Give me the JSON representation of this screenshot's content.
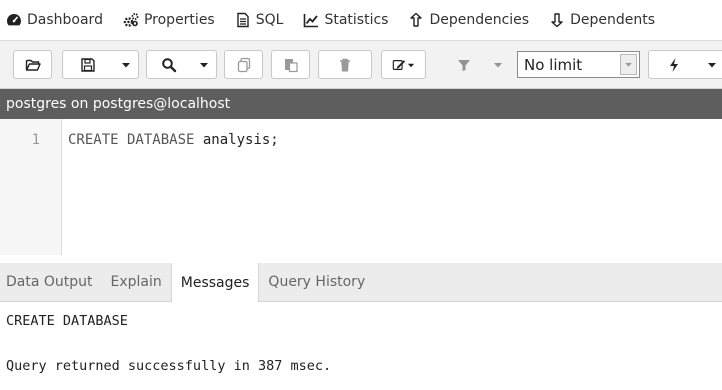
{
  "tabs": [
    {
      "label": "Dashboard",
      "icon": "dashboard-icon"
    },
    {
      "label": "Properties",
      "icon": "properties-icon"
    },
    {
      "label": "SQL",
      "icon": "sql-icon"
    },
    {
      "label": "Statistics",
      "icon": "statistics-icon"
    },
    {
      "label": "Dependencies",
      "icon": "dependencies-icon"
    },
    {
      "label": "Dependents",
      "icon": "dependents-icon"
    }
  ],
  "toolbar": {
    "buttons": [
      "open-file-icon",
      "save-icon",
      "find-icon",
      "copy-icon",
      "paste-icon",
      "delete-icon",
      "edit-icon",
      "filter-icon",
      "execute-icon"
    ],
    "limit_value": "No limit"
  },
  "connection": {
    "label": "postgres on postgres@localhost"
  },
  "editor": {
    "line_number": "1",
    "code_keyword": "CREATE DATABASE",
    "code_identifier": "analysis;"
  },
  "result_tabs": [
    {
      "label": "Data Output",
      "active": false
    },
    {
      "label": "Explain",
      "active": false
    },
    {
      "label": "Messages",
      "active": true
    },
    {
      "label": "Query History",
      "active": false
    }
  ],
  "messages": {
    "line1": "CREATE DATABASE",
    "line2": "Query returned successfully in 387 msec."
  },
  "colors": {
    "connection_bar": "#5e5e5e",
    "toolbar_bg": "#f2f2f2"
  }
}
